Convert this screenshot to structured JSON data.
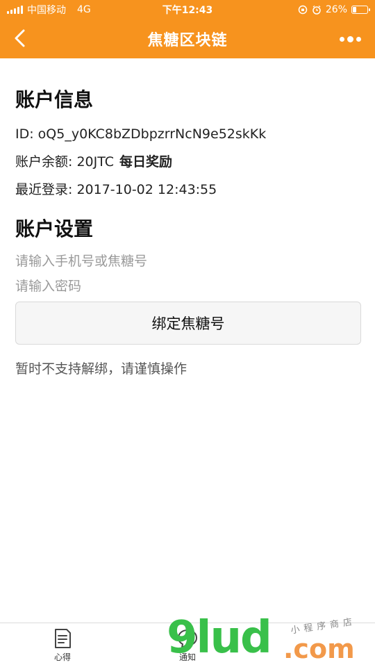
{
  "status_bar": {
    "carrier": "中国移动",
    "network": "4G",
    "time": "下午12:43",
    "battery": "26%",
    "battery_level": 0.26
  },
  "nav": {
    "title": "焦糖区块链"
  },
  "account_info": {
    "title": "账户信息",
    "id_line": "ID: oQ5_y0KC8bZDbpzrrNcN9e52skKk",
    "balance_label": "账户余额: 20JTC",
    "daily_reward": "每日奖励",
    "last_login": "最近登录: 2017-10-02 12:43:55"
  },
  "account_settings": {
    "title": "账户设置",
    "phone_placeholder": "请输入手机号或焦糖号",
    "password_placeholder": "请输入密码",
    "bind_button": "绑定焦糖号",
    "note": "暂时不支持解绑，请谨慎操作"
  },
  "tabbar": {
    "tabs": [
      {
        "label": "心得",
        "icon": "document-icon"
      },
      {
        "label": "通知",
        "icon": "chat-bubble-icon"
      }
    ]
  },
  "watermark": {
    "main": "9lud",
    "com": ".com",
    "sub": "小程序商店"
  },
  "colors": {
    "accent": "#f7931e",
    "watermark_green": "#39c04a",
    "watermark_orange": "#f2994a"
  }
}
